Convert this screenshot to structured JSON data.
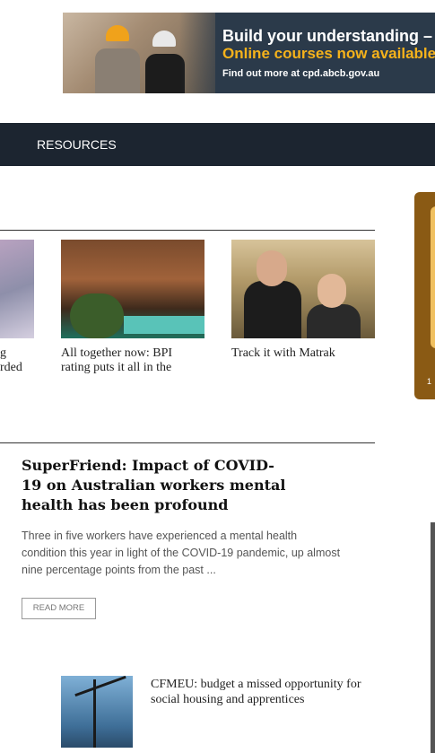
{
  "banner": {
    "line1": "Build your understanding – w",
    "line2": "Online courses now available!",
    "line3": "Find out more at cpd.abcb.gov.au"
  },
  "nav": {
    "items": [
      "RESOURCES"
    ]
  },
  "thumbs": [
    {
      "caption": "g\nrded"
    },
    {
      "caption": "All together now: BPI\nrating puts it all in the"
    },
    {
      "caption": "Track it with Matrak"
    }
  ],
  "article": {
    "title": "SuperFriend: Impact of COVID-19 on Australian workers mental health has been profound",
    "excerpt": "Three in five workers have experienced a mental health condition this year in light of the COVID-19 pandemic, up almost nine percentage points from the past ...",
    "button": "READ MORE"
  },
  "small_article": {
    "title": "CFMEU: budget a missed opportunity for social housing and apprentices"
  },
  "sidebar": {
    "number": "1"
  },
  "colors": {
    "nav_bg": "#1c2530",
    "accent": "#f5b21b",
    "side_box": "#8a5a14"
  }
}
